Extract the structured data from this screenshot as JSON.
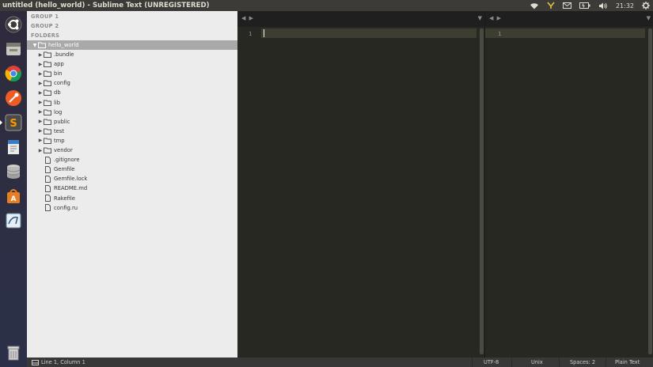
{
  "window": {
    "title": "untitled (hello_world) - Sublime Text (UNREGISTERED)"
  },
  "panel": {
    "clock": "21:32",
    "icons": [
      "wifi-icon",
      "network-icon",
      "mail-icon",
      "battery-icon",
      "volume-icon",
      "settings-gear-icon"
    ]
  },
  "launcher": {
    "apps": [
      {
        "name": "ubuntu-dash-icon"
      },
      {
        "name": "files-icon"
      },
      {
        "name": "chrome-icon"
      },
      {
        "name": "postman-icon"
      },
      {
        "name": "sublime-text-icon"
      },
      {
        "name": "document-viewer-icon"
      },
      {
        "name": "database-icon"
      },
      {
        "name": "software-center-icon"
      },
      {
        "name": "mysql-workbench-icon"
      },
      {
        "name": "trash-icon"
      }
    ]
  },
  "sidebar": {
    "groups": [
      "GROUP 1",
      "GROUP 2"
    ],
    "folders_label": "FOLDERS",
    "root": "hello_world",
    "folders": [
      ".bundle",
      "app",
      "bin",
      "config",
      "db",
      "lib",
      "log",
      "public",
      "test",
      "tmp",
      "vendor"
    ],
    "files": [
      ".gitignore",
      "Gemfile",
      "Gemfile.lock",
      "README.md",
      "Rakefile",
      "config.ru"
    ]
  },
  "editor": {
    "left_pane": {
      "line_number": "1",
      "nav": "◀ ▶",
      "dropdown": "▼"
    },
    "right_pane": {
      "line_number": "1",
      "nav": "◀ ▶",
      "dropdown": "▼"
    }
  },
  "status_bar": {
    "position": "Line 1, Column 1",
    "encoding": "UTF-8",
    "line_endings": "Unix",
    "indentation": "Spaces: 2",
    "syntax": "Plain Text"
  }
}
